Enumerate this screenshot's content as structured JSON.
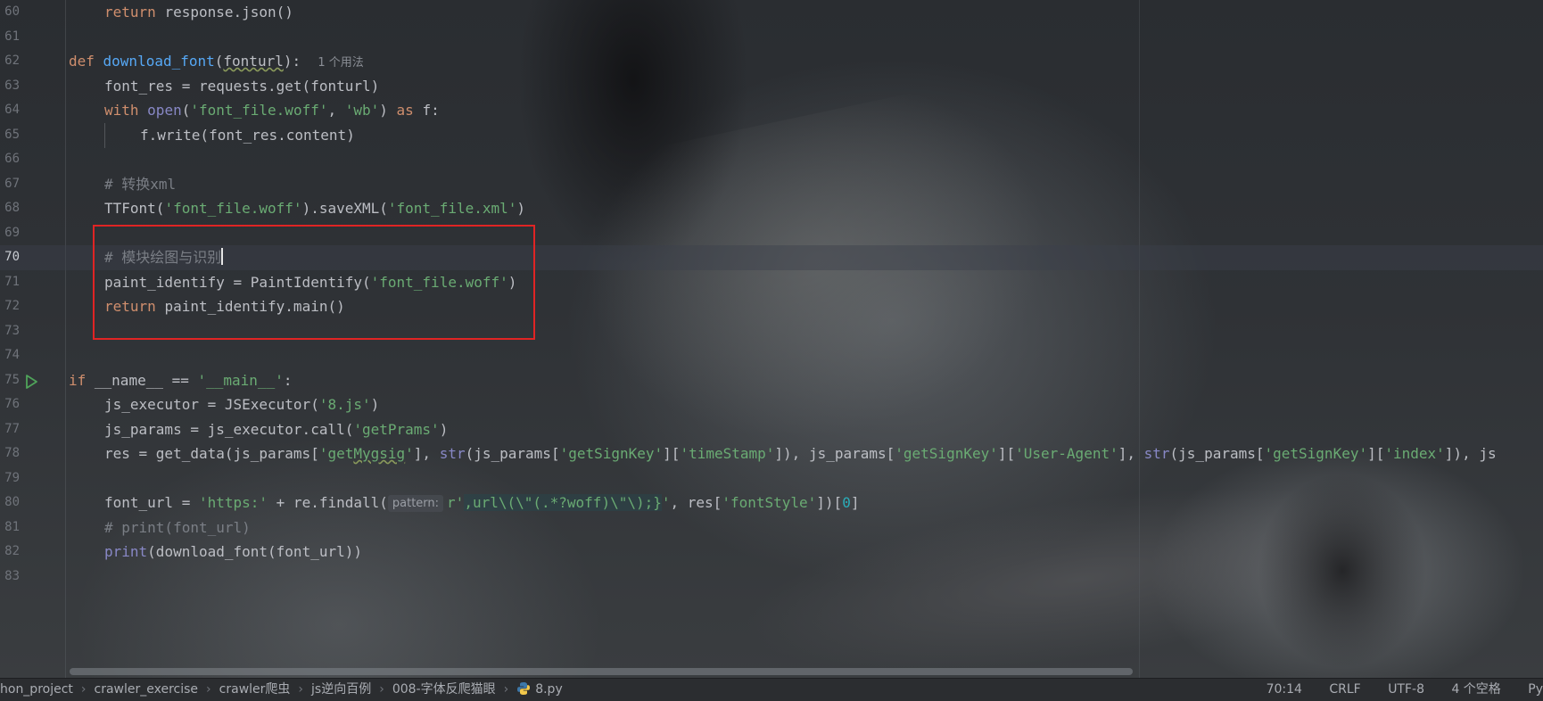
{
  "editor": {
    "lines": [
      {
        "num": "60",
        "indent": 1,
        "tokens": [
          [
            "kw",
            "return "
          ],
          [
            "plain",
            "response.json()"
          ]
        ]
      },
      {
        "num": "61",
        "indent": 0,
        "tokens": []
      },
      {
        "num": "62",
        "indent": 0,
        "tokens": [
          [
            "kw",
            "def "
          ],
          [
            "fn",
            "download_font"
          ],
          [
            "plain",
            "("
          ],
          [
            "ul",
            "fonturl"
          ],
          [
            "plain",
            "):  "
          ],
          [
            "hint",
            "1 个用法"
          ]
        ]
      },
      {
        "num": "63",
        "indent": 1,
        "tokens": [
          [
            "plain",
            "font_res = requests.get(fonturl)"
          ]
        ]
      },
      {
        "num": "64",
        "indent": 1,
        "tokens": [
          [
            "kw",
            "with "
          ],
          [
            "bi",
            "open"
          ],
          [
            "plain",
            "("
          ],
          [
            "str",
            "'font_file.woff'"
          ],
          [
            "plain",
            ", "
          ],
          [
            "str",
            "'wb'"
          ],
          [
            "plain",
            ") "
          ],
          [
            "kw",
            "as "
          ],
          [
            "plain",
            "f:"
          ]
        ]
      },
      {
        "num": "65",
        "indent": 2,
        "tokens": [
          [
            "plain",
            "f.write(font_res.content)"
          ]
        ]
      },
      {
        "num": "66",
        "indent": 0,
        "tokens": []
      },
      {
        "num": "67",
        "indent": 1,
        "tokens": [
          [
            "cm",
            "# 转换xml"
          ]
        ]
      },
      {
        "num": "68",
        "indent": 1,
        "tokens": [
          [
            "plain",
            "TTFont("
          ],
          [
            "str",
            "'font_file.woff'"
          ],
          [
            "plain",
            ").saveXML("
          ],
          [
            "str",
            "'font_file.xml'"
          ],
          [
            "plain",
            ")"
          ]
        ]
      },
      {
        "num": "69",
        "indent": 0,
        "tokens": []
      },
      {
        "num": "70",
        "indent": 1,
        "current": true,
        "tokens": [
          [
            "cm",
            "# 模块绘图与识别"
          ],
          [
            "caret",
            ""
          ]
        ]
      },
      {
        "num": "71",
        "indent": 1,
        "tokens": [
          [
            "plain",
            "paint_identify = PaintIdentify("
          ],
          [
            "str",
            "'font_file.woff'"
          ],
          [
            "plain",
            ")"
          ]
        ]
      },
      {
        "num": "72",
        "indent": 1,
        "tokens": [
          [
            "kw",
            "return "
          ],
          [
            "plain",
            "paint_identify.main()"
          ]
        ]
      },
      {
        "num": "73",
        "indent": 0,
        "tokens": []
      },
      {
        "num": "74",
        "indent": 0,
        "tokens": []
      },
      {
        "num": "75",
        "indent": 0,
        "tokens": [
          [
            "kw",
            "if "
          ],
          [
            "plain",
            "__name__ == "
          ],
          [
            "str",
            "'__main__'"
          ],
          [
            "plain",
            ":"
          ]
        ]
      },
      {
        "num": "76",
        "indent": 1,
        "tokens": [
          [
            "plain",
            "js_executor = JSExecutor("
          ],
          [
            "str",
            "'8.js'"
          ],
          [
            "plain",
            ")"
          ]
        ]
      },
      {
        "num": "77",
        "indent": 1,
        "tokens": [
          [
            "plain",
            "js_params = js_executor.call("
          ],
          [
            "str",
            "'getPrams'"
          ],
          [
            "plain",
            ")"
          ]
        ]
      },
      {
        "num": "78",
        "indent": 1,
        "tokens": [
          [
            "plain",
            "res = get_data(js_params["
          ],
          [
            "str",
            "'get"
          ],
          [
            "strul",
            "Mygsig"
          ],
          [
            "str",
            "'"
          ],
          [
            "plain",
            "], "
          ],
          [
            "bi",
            "str"
          ],
          [
            "plain",
            "(js_params["
          ],
          [
            "str",
            "'getSignKey'"
          ],
          [
            "plain",
            "]["
          ],
          [
            "str",
            "'timeStamp'"
          ],
          [
            "plain",
            "]), js_params["
          ],
          [
            "str",
            "'getSignKey'"
          ],
          [
            "plain",
            "]["
          ],
          [
            "str",
            "'User-Agent'"
          ],
          [
            "plain",
            "], "
          ],
          [
            "bi",
            "str"
          ],
          [
            "plain",
            "(js_params["
          ],
          [
            "str",
            "'getSignKey'"
          ],
          [
            "plain",
            "]["
          ],
          [
            "str",
            "'index'"
          ],
          [
            "plain",
            "]), js"
          ]
        ]
      },
      {
        "num": "79",
        "indent": 0,
        "tokens": []
      },
      {
        "num": "80",
        "indent": 1,
        "tokens": [
          [
            "plain",
            "font_url = "
          ],
          [
            "str",
            "'https:'"
          ],
          [
            "plain",
            " + re.findall("
          ],
          [
            "phint",
            "pattern:"
          ],
          [
            "str",
            "r'"
          ],
          [
            "regex",
            ",url\\(\\\"(.*?woff)\\\"\\);}"
          ],
          [
            "str",
            "'"
          ],
          [
            "plain",
            ", res["
          ],
          [
            "str",
            "'fontStyle'"
          ],
          [
            "plain",
            "])["
          ],
          [
            "num",
            "0"
          ],
          [
            "plain",
            "]"
          ]
        ]
      },
      {
        "num": "81",
        "indent": 1,
        "tokens": [
          [
            "cm",
            "# print(font_url)"
          ]
        ]
      },
      {
        "num": "82",
        "indent": 1,
        "tokens": [
          [
            "bi",
            "print"
          ],
          [
            "plain",
            "(download_font(font_url))"
          ]
        ]
      },
      {
        "num": "83",
        "indent": 0,
        "tokens": []
      }
    ]
  },
  "statusbar": {
    "breadcrumbs": [
      "hon_project",
      "crawler_exercise",
      "crawler爬虫",
      "js逆向百例",
      "008-字体反爬猫眼",
      "8.py"
    ],
    "position": "70:14",
    "line_ending": "CRLF",
    "encoding": "UTF-8",
    "indent": "4 个空格",
    "lang": "Py"
  },
  "colors": {
    "highlight_box": "#e02424",
    "keyword": "#cf8e6d",
    "function": "#56a8f5",
    "string": "#6aab73",
    "builtin": "#8888c6",
    "comment": "#7a7e85",
    "run_icon": "#4fa35a"
  },
  "icons": {
    "run": "run-triangle-icon",
    "python": "python-file-icon",
    "breadcrumb_separator": "chevron-right-icon"
  }
}
